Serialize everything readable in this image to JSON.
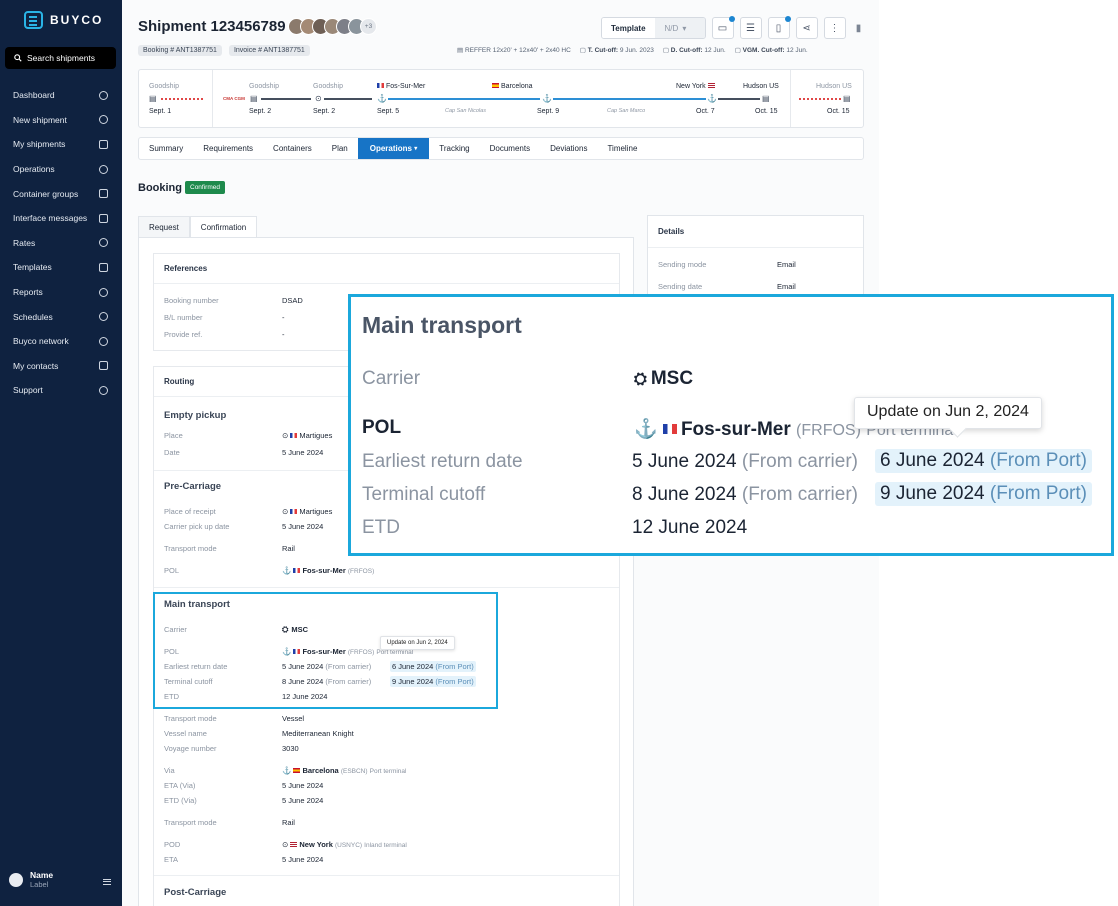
{
  "sidebar": {
    "brand": "BUYCO",
    "search_label": "Search shipments",
    "items": [
      {
        "label": "Dashboard"
      },
      {
        "label": "New shipment"
      },
      {
        "label": "My shipments"
      },
      {
        "label": "Operations"
      },
      {
        "label": "Container groups"
      },
      {
        "label": "Interface messages"
      },
      {
        "label": "Rates"
      },
      {
        "label": "Templates"
      },
      {
        "label": "Reports"
      },
      {
        "label": "Schedules"
      },
      {
        "label": "Buyco network"
      },
      {
        "label": "My contacts"
      },
      {
        "label": "Support"
      }
    ],
    "user": {
      "name": "Name",
      "label": "Label"
    }
  },
  "header": {
    "title": "Shipment 123456789",
    "avatars_more": "+3",
    "booking_chip": "Booking #  ANT1387751",
    "invoice_chip": "Invoice #  ANT1387751",
    "containers": "REFFER 12x20' + 12x40' + 2x40 HC",
    "t_cutoff_label": "T. Cut-off:",
    "t_cutoff": "9 Jun. 2023",
    "d_cutoff_label": "D. Cut-off:",
    "d_cutoff": "12 Jun.",
    "vgm_cutoff_label": "VGM. Cut-off:",
    "vgm_cutoff": "12 Jun.",
    "template_label": "Template",
    "template_value": "N/D"
  },
  "route": {
    "start": {
      "name": "Goodship",
      "date": "Sept. 1"
    },
    "stops": [
      {
        "name": "Goodship",
        "date": "Sept. 2"
      },
      {
        "name": "Goodship",
        "date": "Sept. 2"
      },
      {
        "name": "Fos-Sur-Mer",
        "date": "Sept. 5"
      },
      {
        "name": "Barcelona",
        "date": "Sept. 9"
      },
      {
        "name": "New York",
        "date": "Oct. 7"
      },
      {
        "name": "Hudson US",
        "date": "Oct. 15"
      }
    ],
    "end": {
      "name": "Hudson US",
      "date": "Oct. 15"
    },
    "vessels": [
      "Cap San Nicolas",
      "Cap San Marco"
    ],
    "carrier_logo": "CMA CGM"
  },
  "tabs": [
    "Summary",
    "Requirements",
    "Containers",
    "Plan",
    "Operations",
    "Tracking",
    "Documents",
    "Deviations",
    "Timeline"
  ],
  "booking": {
    "title": "Booking",
    "status": "Confirmed",
    "subtabs": [
      "Request",
      "Confirmation"
    ]
  },
  "references": {
    "title": "References",
    "booking_number_label": "Booking number",
    "booking_number": "DSAD",
    "bl_label": "B/L number",
    "bl": "-",
    "provide_ref_label": "Provide ref.",
    "provide_ref": "-"
  },
  "routing": {
    "title": "Routing",
    "empty_pickup": {
      "title": "Empty pickup",
      "place_label": "Place",
      "place": "Martigues",
      "date_label": "Date",
      "date": "5 June 2024"
    },
    "pre_carriage": {
      "title": "Pre-Carriage",
      "receipt_label": "Place of receipt",
      "receipt": "Martigues",
      "pickup_label": "Carrier pick up date",
      "pickup": "5 June 2024",
      "mode_label": "Transport mode",
      "mode": "Rail",
      "pol_label": "POL",
      "pol": "Fos-sur-Mer",
      "pol_code": "(FRFOS)"
    },
    "main_transport": {
      "title": "Main transport",
      "carrier_label": "Carrier",
      "carrier": "MSC",
      "pol_label": "POL",
      "pol": "Fos-sur-Mer",
      "pol_code": "(FRFOS)",
      "pol_type": "Port terminal",
      "earliest_label": "Earliest return date",
      "earliest_carrier": "5 June 2024",
      "earliest_port": "6 June 2024",
      "cutoff_label": "Terminal cutoff",
      "cutoff_carrier": "8 June 2024",
      "cutoff_port": "9 June 2024",
      "etd_label": "ETD",
      "etd": "12 June 2024",
      "from_carrier": "(From carrier)",
      "from_port": "(From Port)",
      "tooltip": "Update on Jun 2, 2024",
      "mode_label": "Transport mode",
      "mode": "Vessel",
      "vessel_label": "Vessel name",
      "vessel": "Mediterranean Knight",
      "voyage_label": "Voyage number",
      "voyage": "3030",
      "via_label": "Via",
      "via": "Barcelona",
      "via_code": "(ESBCN)",
      "via_type": "Port terminal",
      "eta_via_label": "ETA (Via)",
      "eta_via": "5 June 2024",
      "etd_via_label": "ETD (Via)",
      "etd_via": "5 June 2024",
      "mode2_label": "Transport mode",
      "mode2": "Rail",
      "pod_label": "POD",
      "pod": "New York",
      "pod_code": "(USNYC)",
      "pod_type": "Inland terminal",
      "eta_label": "ETA",
      "eta": "5 June 2024"
    },
    "post_carriage": {
      "title": "Post-Carriage"
    }
  },
  "details": {
    "title": "Details",
    "sending_mode_label": "Sending mode",
    "sending_mode": "Email",
    "sending_date_label": "Sending date",
    "sending_date": "Email"
  },
  "colors": {
    "sidebar": "#0f2240",
    "accent": "#1774c6",
    "highlight": "#1ba8dc",
    "confirmed": "#1e8a4c"
  }
}
